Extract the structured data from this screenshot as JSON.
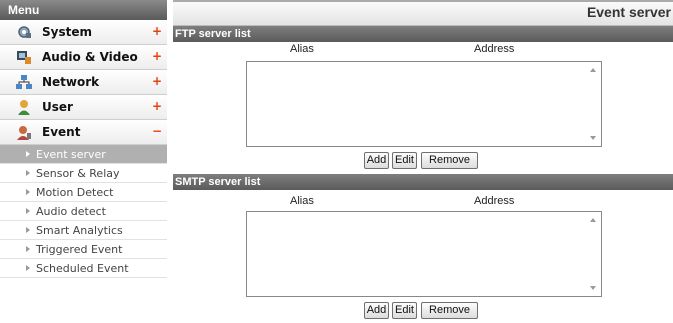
{
  "sidebar": {
    "header": "Menu",
    "items": [
      {
        "label": "System",
        "toggle": "+",
        "icon": "system-gear-icon"
      },
      {
        "label": "Audio & Video",
        "toggle": "+",
        "icon": "audio-video-icon"
      },
      {
        "label": "Network",
        "toggle": "+",
        "icon": "network-icon"
      },
      {
        "label": "User",
        "toggle": "+",
        "icon": "user-icon"
      },
      {
        "label": "Event",
        "toggle": "−",
        "icon": "event-icon"
      }
    ],
    "submenu": [
      {
        "label": "Event server",
        "active": true
      },
      {
        "label": "Sensor & Relay"
      },
      {
        "label": "Motion Detect"
      },
      {
        "label": "Audio detect"
      },
      {
        "label": "Smart Analytics"
      },
      {
        "label": "Triggered Event"
      },
      {
        "label": "Scheduled Event"
      }
    ]
  },
  "main": {
    "title": "Event server",
    "ftp": {
      "heading": "FTP server list",
      "alias_header": "Alias",
      "address_header": "Address",
      "add_label": "Add",
      "edit_label": "Edit",
      "remove_label": "Remove"
    },
    "smtp": {
      "heading": "SMTP server list",
      "alias_header": "Alias",
      "address_header": "Address",
      "add_label": "Add",
      "edit_label": "Edit",
      "remove_label": "Remove"
    }
  },
  "colors": {
    "accent_toggle": "#e8400c",
    "header_bar": "#6b6b6b",
    "active_submenu": "#b0b0b0"
  }
}
